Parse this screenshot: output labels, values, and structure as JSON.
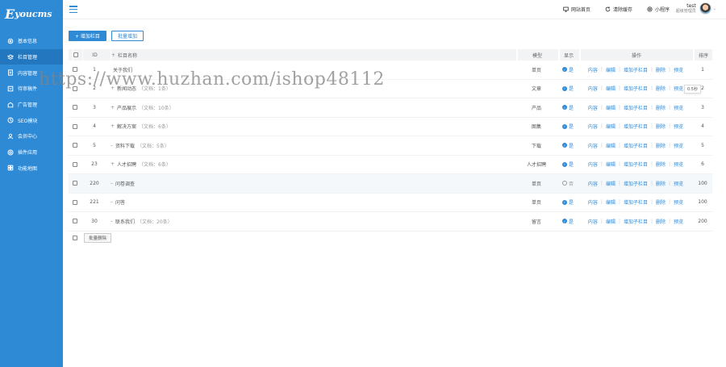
{
  "app": {
    "logo_mark": "E",
    "logo_text": "youcms"
  },
  "sidebar": {
    "items": [
      {
        "label": "基本信息",
        "icon": "gear-icon"
      },
      {
        "label": "栏目管理",
        "icon": "stack-icon",
        "active": true
      },
      {
        "label": "内容管理",
        "icon": "document-icon"
      },
      {
        "label": "待审稿件",
        "icon": "pending-icon"
      },
      {
        "label": "广告管理",
        "icon": "ad-icon"
      },
      {
        "label": "SEO模块",
        "icon": "seo-icon"
      },
      {
        "label": "会员中心",
        "icon": "user-icon"
      },
      {
        "label": "插件应用",
        "icon": "plugin-icon"
      },
      {
        "label": "功能地图",
        "icon": "grid-icon"
      }
    ]
  },
  "topbar": {
    "links": [
      {
        "label": "网站首页",
        "icon": "monitor-icon"
      },
      {
        "label": "清除缓存",
        "icon": "refresh-icon"
      },
      {
        "label": "小程序",
        "icon": "miniapp-icon"
      }
    ],
    "user_name": "test",
    "user_role": "超级管理员"
  },
  "toolbar": {
    "add_label": "+ 增加栏目",
    "batch_add_label": "批量增加"
  },
  "table": {
    "headers": {
      "id": "ID",
      "name": "栏目名称",
      "model": "模型",
      "show": "显示",
      "ops": "操作",
      "sort": "排序"
    },
    "header_name_prefix": "+",
    "ops": [
      "内容",
      "编辑",
      "增加子栏目",
      "删除",
      "预览"
    ],
    "rows": [
      {
        "id": "1",
        "prefix": "",
        "name": "关于我们",
        "count": "",
        "model": "单页",
        "show": "是",
        "visible": true,
        "sort": "1"
      },
      {
        "id": "2",
        "prefix": "+",
        "name": "新闻动态",
        "count": "（文档：1条）",
        "model": "文章",
        "show": "是",
        "visible": true,
        "sort": "2"
      },
      {
        "id": "3",
        "prefix": "+",
        "name": "产品展示",
        "count": "（文档：10条）",
        "model": "产品",
        "show": "是",
        "visible": true,
        "sort": "3"
      },
      {
        "id": "4",
        "prefix": "+",
        "name": "解决方案",
        "count": "（文档：6条）",
        "model": "图集",
        "show": "是",
        "visible": true,
        "sort": "4"
      },
      {
        "id": "5",
        "prefix": "–",
        "name": "资料下载",
        "count": "（文档：5条）",
        "model": "下载",
        "show": "是",
        "visible": true,
        "sort": "5"
      },
      {
        "id": "23",
        "prefix": "+",
        "name": "人才招聘",
        "count": "（文档：6条）",
        "model": "人才招聘",
        "show": "是",
        "visible": true,
        "sort": "6"
      },
      {
        "id": "220",
        "prefix": "–",
        "name": "问卷调查",
        "count": "",
        "model": "单页",
        "show": "否",
        "visible": false,
        "sort": "100"
      },
      {
        "id": "221",
        "prefix": "–",
        "name": "问答",
        "count": "",
        "model": "单页",
        "show": "是",
        "visible": true,
        "sort": "100"
      },
      {
        "id": "30",
        "prefix": "–",
        "name": "联系我们",
        "count": "（文档：20条）",
        "model": "留言",
        "show": "是",
        "visible": true,
        "sort": "200"
      }
    ],
    "tooltip": "0.5秒"
  },
  "footer": {
    "batch_delete_label": "批量删除"
  },
  "watermark": "https://www.huzhan.com/ishop48112",
  "colors": {
    "accent": "#2f8ad6",
    "sidebar_active": "#2377bf"
  }
}
